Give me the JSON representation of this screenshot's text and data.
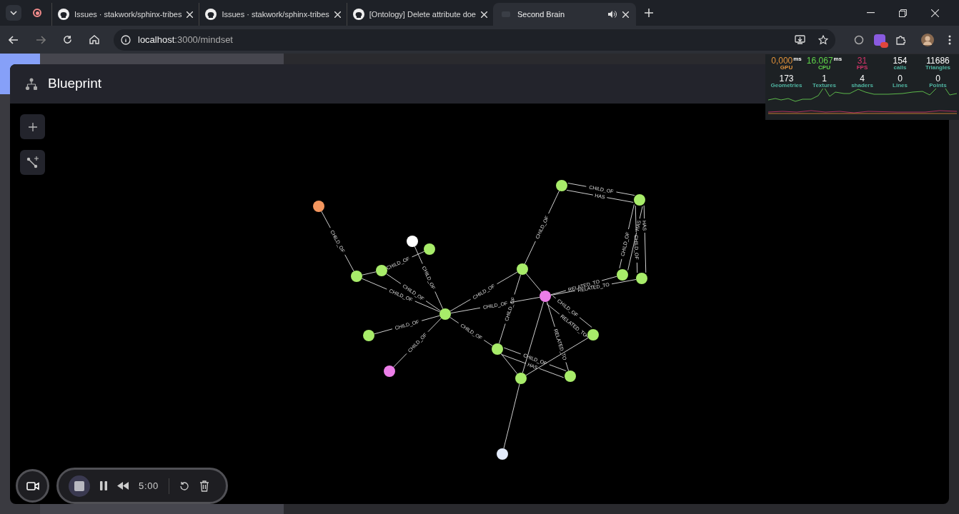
{
  "browser": {
    "tabs": [
      {
        "title": "Issues · stakwork/sphinx-tribes",
        "kind": "github",
        "selected": false
      },
      {
        "title": "Issues · stakwork/sphinx-tribes",
        "kind": "github",
        "selected": false
      },
      {
        "title": "[Ontology] Delete attribute doe",
        "kind": "github",
        "selected": false
      },
      {
        "title": "Second Brain",
        "kind": "app",
        "selected": true,
        "audio": true
      }
    ],
    "url_host": "localhost",
    "url_path": ":3000/mindset"
  },
  "panel": {
    "title": "Blueprint"
  },
  "stats": [
    {
      "value": "0,000",
      "unit": "ms",
      "label": "GPU",
      "color": "#e0913a"
    },
    {
      "value": "16.067",
      "unit": "ms",
      "label": "CPU",
      "color": "#5fd34a"
    },
    {
      "value": "31",
      "label": "FPS",
      "color": "#d2346a"
    },
    {
      "value": "154",
      "label": "calls",
      "color": "#4fb3a0"
    },
    {
      "value": "11686",
      "label": "Triangles",
      "color": "#4fb3a0"
    },
    {
      "value": "173",
      "label": "Geometries",
      "color": "#4fb3a0"
    },
    {
      "value": "1",
      "label": "Textures",
      "color": "#4fb3a0"
    },
    {
      "value": "4",
      "label": "shaders",
      "color": "#4fb3a0"
    },
    {
      "value": "0",
      "label": "Lines",
      "color": "#4fb3a0"
    },
    {
      "value": "0",
      "label": "Points",
      "color": "#4fb3a0"
    }
  ],
  "graph": {
    "nodes": [
      {
        "color": "#f4965e"
      },
      {
        "color": "#ffffff"
      },
      {
        "color": "#a8ec6a"
      },
      {
        "color": "#a8ec6a"
      },
      {
        "color": "#a8ec6a"
      },
      {
        "color": "#a8ec6a"
      },
      {
        "color": "#a8ec6a"
      },
      {
        "color": "#ec7ee8"
      },
      {
        "color": "#a8ec6a"
      },
      {
        "color": "#a8ec6a"
      },
      {
        "color": "#a8ec6a"
      },
      {
        "color": "#a8ec6a"
      },
      {
        "color": "#a8ec6a"
      },
      {
        "color": "#ec7ee8"
      },
      {
        "color": "#a8ec6a"
      },
      {
        "color": "#a8ec6a"
      },
      {
        "color": "#a8ec6a"
      },
      {
        "color": "#a8ec6a"
      },
      {
        "color": "#e4ecfb"
      }
    ],
    "edge_labels": [
      {
        "label": "CHILD_OF"
      },
      {
        "label": "CHILD_OF"
      },
      {
        "label": "CHILD_OF"
      },
      {
        "label": "CHILD_OF"
      },
      {
        "label": "CHILD_OF"
      },
      {
        "label": "CHILD_OF"
      },
      {
        "label": "CHILD_OF"
      },
      {
        "label": "CHILD_OF"
      },
      {
        "label": "CHILD_OF"
      },
      {
        "label": "CHILD_OF"
      },
      {
        "label": "CHILD_OF"
      },
      {
        "label": "CHILD_OF"
      },
      {
        "label": "HAS"
      },
      {
        "label": "HAS"
      },
      {
        "label": "CHILD_OF"
      },
      {
        "label": "HAS"
      },
      {
        "label": "CHILD_OF"
      },
      {
        "label": "RELATED_TO"
      },
      {
        "label": "RELATED_TO"
      },
      {
        "label": "CHILD_OF"
      },
      {
        "label": "CHILD_OF"
      },
      {
        "label": "RELATED_TO"
      },
      {
        "label": "RELATED_TO"
      },
      {
        "label": "CHILD_OF"
      },
      {
        "label": "HAS"
      }
    ]
  },
  "recorder": {
    "time": "5:00"
  }
}
